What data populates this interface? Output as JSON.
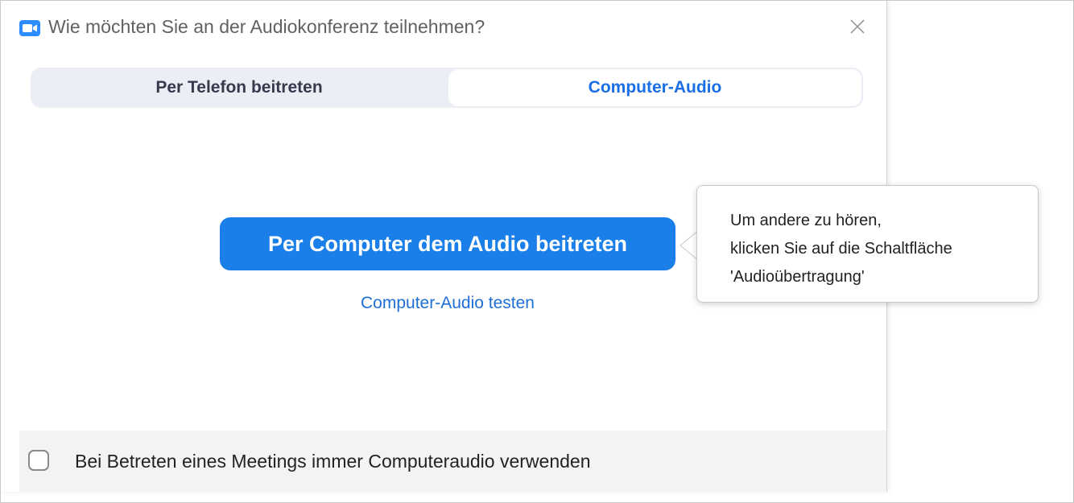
{
  "dialog": {
    "title": "Wie möchten Sie an der Audiokonferenz teilnehmen?",
    "app_icon": "zoom-camera-icon",
    "close_icon": "close-icon"
  },
  "tabs": [
    {
      "label": "Per Telefon beitreten",
      "selected": false
    },
    {
      "label": "Computer-Audio",
      "selected": true
    }
  ],
  "main": {
    "join_button_label": "Per Computer dem Audio beitreten",
    "test_link_label": "Computer-Audio testen"
  },
  "tooltip": {
    "lines": [
      "Um andere zu hören,",
      "klicken Sie auf die Schaltfläche",
      "'Audioübertragung'"
    ]
  },
  "footer": {
    "checkbox_checked": false,
    "checkbox_label": "Bei Betreten eines Meetings immer Computeraudio verwenden"
  },
  "colors": {
    "accent": "#1a7fe8",
    "link": "#1f6fd6",
    "tab_background": "#eceef5"
  }
}
